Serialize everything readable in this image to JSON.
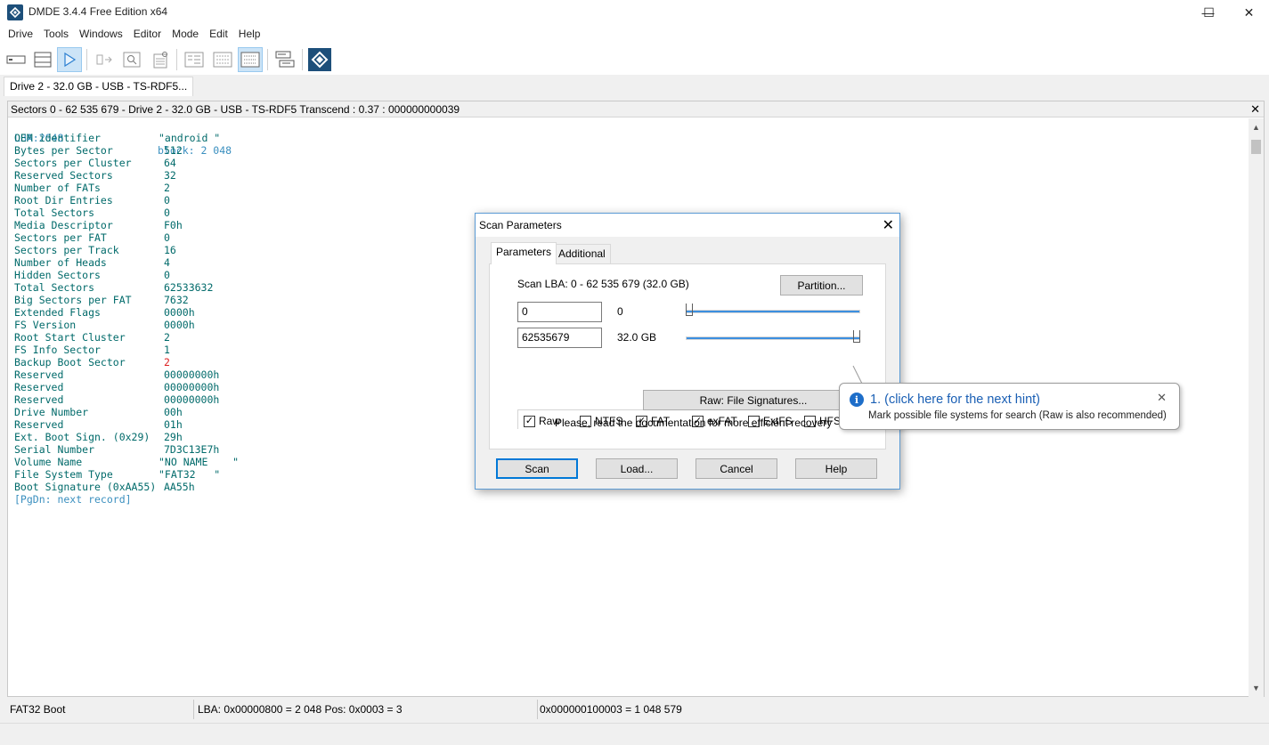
{
  "window": {
    "title": "DMDE 3.4.4 Free Edition x64",
    "minimize_glyph": "—",
    "maximize_glyph": "☐",
    "close_glyph": "✕"
  },
  "menu": [
    "Drive",
    "Tools",
    "Windows",
    "Editor",
    "Mode",
    "Edit",
    "Help"
  ],
  "toolbar": {
    "icons": [
      "drive-icon",
      "partitions-icon",
      "play-icon",
      "open-file-icon",
      "search-icon",
      "settings-icon",
      "hex-view-icon",
      "list-view-icon",
      "table-view-icon",
      "panels-icon",
      "dmde-logo-icon"
    ]
  },
  "doc_tab": {
    "label": "Drive 2 - 32.0 GB - USB - TS-RDF5..."
  },
  "panel": {
    "title": "Sectors 0 - 62 535 679 - Drive 2 - 32.0 GB - USB - TS-RDF5  Transcend : 0.37 : 000000000039",
    "close_glyph": "✕",
    "header_row": {
      "key": "LBA:2048",
      "value": "block: 2 048"
    },
    "rows": [
      {
        "key": "OEM identifier",
        "value": "\"android \""
      },
      {
        "key": "Bytes per Sector",
        "value": "512"
      },
      {
        "key": "Sectors per Cluster",
        "value": "64"
      },
      {
        "key": "Reserved Sectors",
        "value": "32"
      },
      {
        "key": "Number of FATs",
        "value": "2"
      },
      {
        "key": "Root Dir Entries",
        "value": "0"
      },
      {
        "key": "Total Sectors",
        "value": "0"
      },
      {
        "key": "Media Descriptor",
        "value": "F0h"
      },
      {
        "key": "Sectors per FAT",
        "value": "0"
      },
      {
        "key": "Sectors per Track",
        "value": "16"
      },
      {
        "key": "Number of Heads",
        "value": "4"
      },
      {
        "key": "Hidden Sectors",
        "value": "0"
      },
      {
        "key": "Total Sectors",
        "value": "62533632"
      },
      {
        "key": "Big Sectors per FAT",
        "value": "7632"
      },
      {
        "key": "Extended Flags",
        "value": "0000h"
      },
      {
        "key": "FS Version",
        "value": "0000h"
      },
      {
        "key": "Root Start Cluster",
        "value": "2"
      },
      {
        "key": "FS Info Sector",
        "value": "1"
      },
      {
        "key": "Backup Boot Sector",
        "value": "2",
        "highlight": "#dd2222"
      },
      {
        "key": "Reserved",
        "value": "00000000h"
      },
      {
        "key": "Reserved",
        "value": "00000000h"
      },
      {
        "key": "Reserved",
        "value": "00000000h"
      },
      {
        "key": "Drive Number",
        "value": "00h"
      },
      {
        "key": "Reserved",
        "value": "01h"
      },
      {
        "key": "Ext. Boot Sign. (0x29)",
        "value": "29h"
      },
      {
        "key": "Serial Number",
        "value": "7D3C13E7h"
      },
      {
        "key": "Volume Name",
        "value": "\"NO NAME    \""
      },
      {
        "key": "File System Type",
        "value": "\"FAT32   \""
      },
      {
        "key": "Boot Signature (0xAA55)",
        "value": "AA55h"
      }
    ],
    "footer_row": "[PgDn: next record]"
  },
  "statusbar": {
    "type": "FAT32 Boot",
    "position": "LBA: 0x00000800 = 2 048  Pos: 0x0003 = 3",
    "offset": "0x000000100003 = 1 048 579"
  },
  "dialog": {
    "title": "Scan Parameters",
    "close_glyph": "✕",
    "tabs": [
      "Parameters",
      "Additional"
    ],
    "scan_lba": "Scan LBA: 0 - 62 535 679 (32.0 GB)",
    "partition_button": "Partition...",
    "start_value": "0",
    "start_label": "0",
    "end_value": "62535679",
    "end_label": "32.0 GB",
    "filesystems": [
      {
        "label": "Raw",
        "checked": true
      },
      {
        "label": "NTFS",
        "checked": false
      },
      {
        "label": "FAT",
        "checked": true
      },
      {
        "label": "exFAT",
        "checked": true
      },
      {
        "label": "ExtFS",
        "checked": false
      },
      {
        "label": "HFS",
        "checked": false
      }
    ],
    "signatures_button": "Raw: File Signatures...",
    "doc_note": "Please, read the documentation for more efficient recovery",
    "buttons": {
      "scan": "Scan",
      "load": "Load...",
      "cancel": "Cancel",
      "help": "Help"
    }
  },
  "hint": {
    "title": "1. (click here for the next hint)",
    "message": "Mark possible file systems for search (Raw is also recommended)",
    "close_glyph": "✕"
  }
}
